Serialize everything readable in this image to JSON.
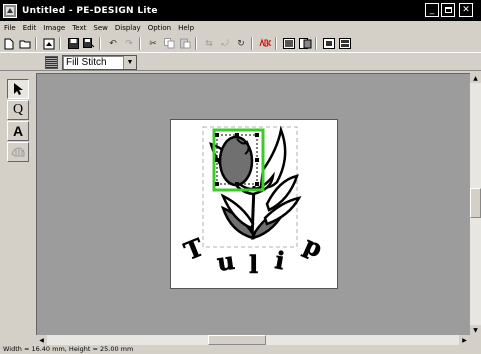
{
  "window": {
    "title": "Untitled - PE-DESIGN Lite"
  },
  "menu": [
    {
      "label": "File",
      "key": "F"
    },
    {
      "label": "Edit",
      "key": "E"
    },
    {
      "label": "Image",
      "key": "I"
    },
    {
      "label": "Text",
      "key": "T"
    },
    {
      "label": "Sew",
      "key": "S"
    },
    {
      "label": "Display",
      "key": "D"
    },
    {
      "label": "Option",
      "key": "O"
    },
    {
      "label": "Help",
      "key": "H"
    }
  ],
  "toolbar": [
    "new-icon",
    "open-icon",
    "import-icon",
    "save-icon",
    "save-as-icon",
    "undo-icon",
    "redo-icon",
    "cut-icon",
    "copy-icon",
    "paste-icon",
    "mirror-icon",
    "rotate-icon",
    "refresh-icon",
    "abc-icon",
    "layout-icon",
    "card-icon",
    "preview-icon",
    "design-icon"
  ],
  "stitch": {
    "value": "Fill Stitch"
  },
  "tools": [
    "select-tool",
    "zoom-tool",
    "text-tool",
    "shape-tool"
  ],
  "tool_letters": {
    "zoom": "Q",
    "text": "A"
  },
  "design": {
    "letters": [
      "T",
      "u",
      "l",
      "i",
      "p"
    ]
  },
  "status": {
    "text": "Width  = 16.40 mm, Height = 25.00 mm"
  },
  "colors": {
    "selection": "#3ccc2a",
    "fill": "#707070",
    "outline": "#000000"
  }
}
